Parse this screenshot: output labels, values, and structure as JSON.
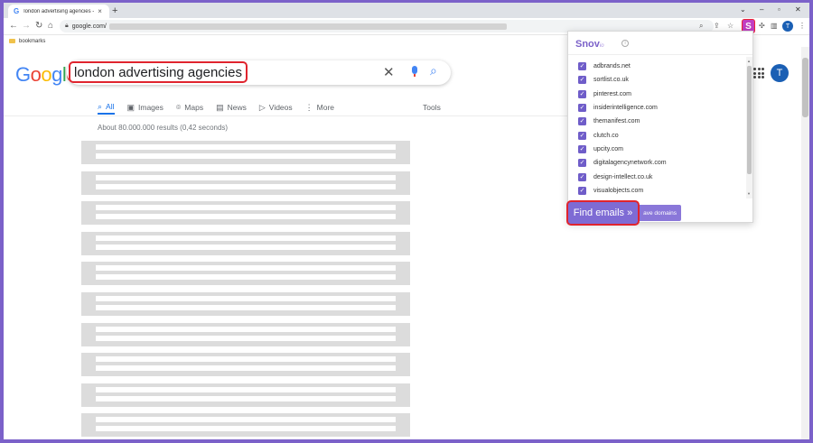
{
  "browser": {
    "tab_title": "london advertising agencies - G",
    "tab_favicon": "G",
    "url": "google.com/",
    "bookmarks_label": "bookmarks",
    "profile_initial": "T",
    "extension_letter": "S"
  },
  "google": {
    "query": "london advertising agencies",
    "avatar_initial": "T",
    "tabs": [
      {
        "label": "All",
        "icon": "search-icon",
        "glyph": "⌕"
      },
      {
        "label": "Images",
        "icon": "image-icon",
        "glyph": "▣"
      },
      {
        "label": "Maps",
        "icon": "map-pin-icon",
        "glyph": "⌾"
      },
      {
        "label": "News",
        "icon": "news-icon",
        "glyph": "▤"
      },
      {
        "label": "Videos",
        "icon": "video-icon",
        "glyph": "▷"
      },
      {
        "label": "More",
        "icon": "more-vert-icon",
        "glyph": "⋮"
      }
    ],
    "tools_label": "Tools",
    "result_stats": "About 80.000.000 results (0,42 seconds)",
    "placeholder_result_count": 10
  },
  "snov": {
    "logo": "Snov",
    "logo_suffix": "io",
    "domains": [
      {
        "domain": "adbrands.net",
        "checked": true
      },
      {
        "domain": "sortlist.co.uk",
        "checked": true
      },
      {
        "domain": "pinterest.com",
        "checked": true
      },
      {
        "domain": "insiderintelligence.com",
        "checked": true
      },
      {
        "domain": "themanifest.com",
        "checked": true
      },
      {
        "domain": "clutch.co",
        "checked": true
      },
      {
        "domain": "upcity.com",
        "checked": true
      },
      {
        "domain": "digitalagencynetwork.com",
        "checked": true
      },
      {
        "domain": "design-intellect.co.uk",
        "checked": true
      },
      {
        "domain": "visualobjects.com",
        "checked": true
      }
    ],
    "find_button": "Find emails »",
    "save_button": "ave domains"
  },
  "colors": {
    "accent": "#7b61c9",
    "highlight_border": "#e0242e",
    "google_blue": "#1a73e8"
  }
}
